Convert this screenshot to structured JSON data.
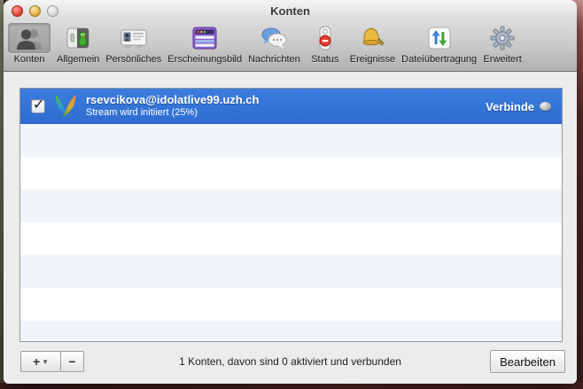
{
  "window": {
    "title": "Konten"
  },
  "toolbar": {
    "items": [
      {
        "label": "Konten",
        "icon": "accounts-icon",
        "selected": true
      },
      {
        "label": "Allgemein",
        "icon": "general-icon",
        "selected": false
      },
      {
        "label": "Persönliches",
        "icon": "personal-info-icon",
        "selected": false
      },
      {
        "label": "Erscheinungsbild",
        "icon": "appearance-icon",
        "selected": false
      },
      {
        "label": "Nachrichten",
        "icon": "messages-icon",
        "selected": false
      },
      {
        "label": "Status",
        "icon": "status-icon",
        "selected": false
      },
      {
        "label": "Ereignisse",
        "icon": "events-bell-icon",
        "selected": false
      },
      {
        "label": "Dateiübertragung",
        "icon": "file-transfer-icon",
        "selected": false
      },
      {
        "label": "Erweitert",
        "icon": "advanced-gear-icon",
        "selected": false
      }
    ]
  },
  "accounts_list": {
    "rows": [
      {
        "enabled": true,
        "service_icon": "xmpp-feathers-icon",
        "account": "rsevcikova@idolatlive99.uzh.ch",
        "status": "Stream wird initiiert (25%)",
        "action": "Verbinde",
        "status_bubble": "connecting-gray-bubble"
      }
    ],
    "empty_rows": 7
  },
  "footer": {
    "add_label": "+",
    "add_caret": "▼",
    "remove_label": "−",
    "summary": "1 Konten, davon sind 0 aktiviert und verbunden",
    "edit_label": "Bearbeiten"
  },
  "colors": {
    "selection_blue": "#3375d9",
    "row_alt": "#f1f5fa",
    "content_bg": "#ececec",
    "desktop_maroon": "#40201f",
    "desktop_olive": "#6e6e5a",
    "desktop_pink": "#c89290"
  }
}
